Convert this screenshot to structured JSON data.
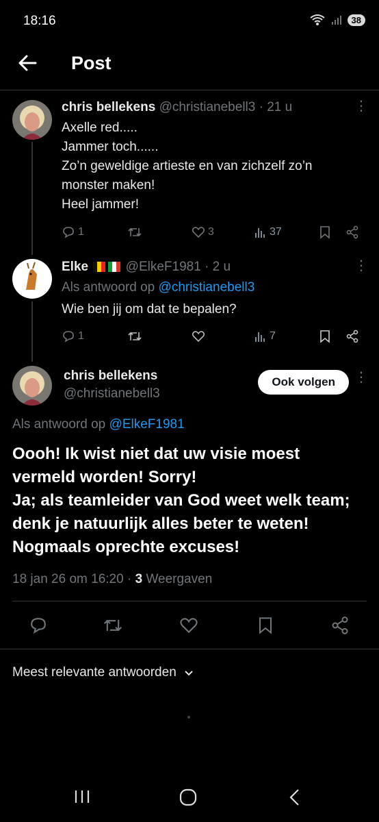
{
  "status_bar": {
    "time": "18:16",
    "battery": "38"
  },
  "header": {
    "title": "Post"
  },
  "tweet1": {
    "name": "chris bellekens",
    "handle": "@christianebell3",
    "time": "· 21 u",
    "lines": [
      "Axelle red.....",
      "Jammer toch......",
      "Zo’n geweldige artieste en van zichzelf zo’n",
      "monster maken!",
      "Heel jammer!"
    ],
    "replies": "1",
    "likes": "3",
    "views": "37"
  },
  "tweet2": {
    "name": "Elke",
    "handle": "@ElkeF1981",
    "time": "· 2 u",
    "reply_prefix": "Als antwoord op",
    "reply_to": "@christianebell3",
    "text": "Wie ben jij om dat te bepalen?",
    "replies": "1",
    "views": "7"
  },
  "main_post": {
    "name": "chris bellekens",
    "handle": "@christianebell3",
    "follow_label": "Ook volgen",
    "reply_prefix": "Als antwoord op",
    "reply_to": "@ElkeF1981",
    "lines": [
      "Oooh! Ik wist niet dat uw visie moest",
      "vermeld worden! Sorry!",
      "Ja; als teamleider van God weet welk team;",
      "denk je natuurlijk alles beter te weten!",
      "Nogmaals oprechte excuses!"
    ],
    "date": "18 jan 26 om 16:20 ·",
    "views_count": "3",
    "views_label": "Weergaven"
  },
  "sort": {
    "label": "Meest relevante antwoorden"
  },
  "colors": {
    "accent": "#1d9bf0",
    "muted": "#71767b",
    "background": "#000000"
  },
  "icons": [
    "back-arrow-icon",
    "reply-icon",
    "retweet-icon",
    "like-icon",
    "views-icon",
    "bookmark-icon",
    "share-icon",
    "more-icon",
    "chevron-down-icon"
  ]
}
